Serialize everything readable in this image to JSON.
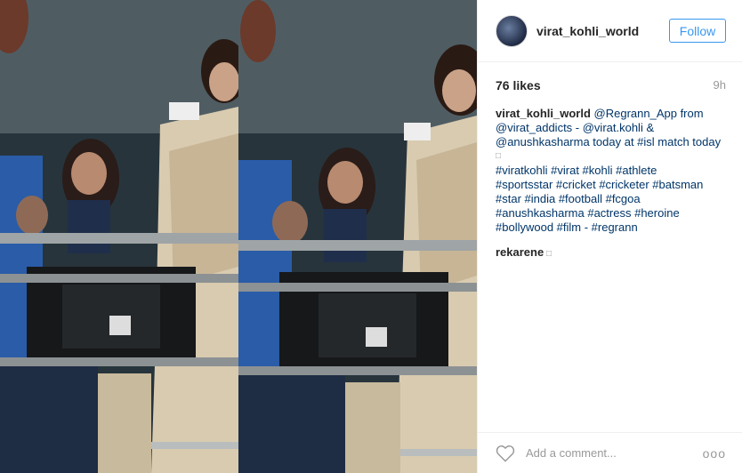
{
  "post": {
    "username": "virat_kohli_world",
    "follow_label": "Follow",
    "likes": "76 likes",
    "time": "9h",
    "caption": {
      "username": "virat_kohli_world",
      "line1_rest": " @Regrann_App from",
      "line2": "@virat_addicts - @virat.kohli &",
      "line3": "@anushkasharma today at #isl match today",
      "line4": "□",
      "line5": "#viratkohli #virat #kohli #athlete",
      "line6": "#sportsstar #cricket #cricketer #batsman",
      "line7": "#star #india #football #fcgoa",
      "line8": "#anushkasharma #actress #heroine",
      "line9": "#bollywood #film - #regrann"
    },
    "comment": {
      "username": "rekarene",
      "text": " □"
    },
    "add_comment_placeholder": "Add a comment...",
    "more_label": "ooo"
  }
}
